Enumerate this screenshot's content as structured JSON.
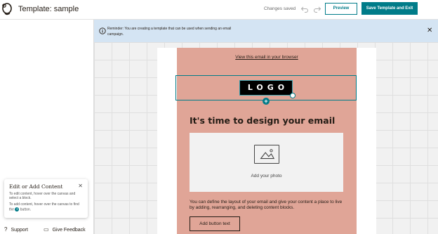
{
  "header": {
    "title": "Template: sample",
    "status": "Changes saved",
    "preview_label": "Preview",
    "save_label": "Save Template and Exit"
  },
  "banner": {
    "text": "Reminder: You are creating a template that can be used when sending an email campaign.",
    "close_glyph": "✕"
  },
  "help_card": {
    "title": "Edit or Add Content",
    "close_glyph": "✕",
    "line1": "To edit content, hover over the canvas and select a block.",
    "line2_before": "To add content, hover over the canvas to find the",
    "line2_after": "button."
  },
  "footer": {
    "support": "Support",
    "feedback": "Give Feedback"
  },
  "email": {
    "view_in_browser": "View this email in your browser",
    "logo_text": "LOGO",
    "heading": "It's time to design your email",
    "photo_label": "Add your photo",
    "body": "You can define the layout of your email and give your content a place to live by adding, rearranging, and deleting content blocks.",
    "button_text": "Add button text"
  },
  "colors": {
    "accent": "#007c89",
    "banner_bg": "#d4e4f3",
    "email_bg": "#e0a597"
  },
  "icons": [
    "mailchimp-logo-icon",
    "undo-icon",
    "redo-icon",
    "info-icon",
    "close-icon",
    "image-placeholder-icon",
    "add-block-plus-icon",
    "help-icon",
    "feedback-icon"
  ]
}
